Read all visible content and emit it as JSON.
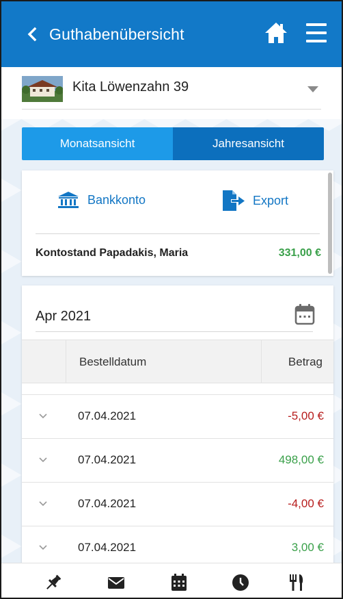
{
  "header": {
    "title": "Guthabenübersicht",
    "back_icon": "chevron-left-icon",
    "home_icon": "home-icon",
    "menu_icon": "hamburger-menu-icon"
  },
  "selector": {
    "label": "Kita Löwenzahn 39",
    "caret_icon": "caret-down-icon"
  },
  "tabs": [
    {
      "label": "Monatsansicht",
      "active": true
    },
    {
      "label": "Jahresansicht",
      "active": false
    }
  ],
  "actions": {
    "bank_label": "Bankkonto",
    "export_label": "Export"
  },
  "balance": {
    "label": "Kontostand Papadakis, Maria",
    "value": "331,00 €",
    "value_color": "#3aa04a"
  },
  "month": {
    "value": "Apr 2021",
    "calendar_icon": "calendar-icon"
  },
  "table": {
    "headers": {
      "date": "Bestelldatum",
      "amount": "Betrag"
    },
    "rows": [
      {
        "date": "07.04.2021",
        "amount": "-5,00 €",
        "type": "neg"
      },
      {
        "date": "07.04.2021",
        "amount": "498,00 €",
        "type": "pos"
      },
      {
        "date": "07.04.2021",
        "amount": "-4,00 €",
        "type": "neg"
      },
      {
        "date": "07.04.2021",
        "amount": "3,00 €",
        "type": "pos"
      }
    ]
  },
  "bottom_nav": [
    "pin-icon",
    "mail-icon",
    "calendar-grid-icon",
    "clock-icon",
    "cutlery-icon"
  ],
  "colors": {
    "brand": "#1279c8",
    "tab_active": "#1d9ae8",
    "tab_inactive": "#0c6fbd",
    "negative": "#b71c1c",
    "positive": "#3aa04a"
  }
}
